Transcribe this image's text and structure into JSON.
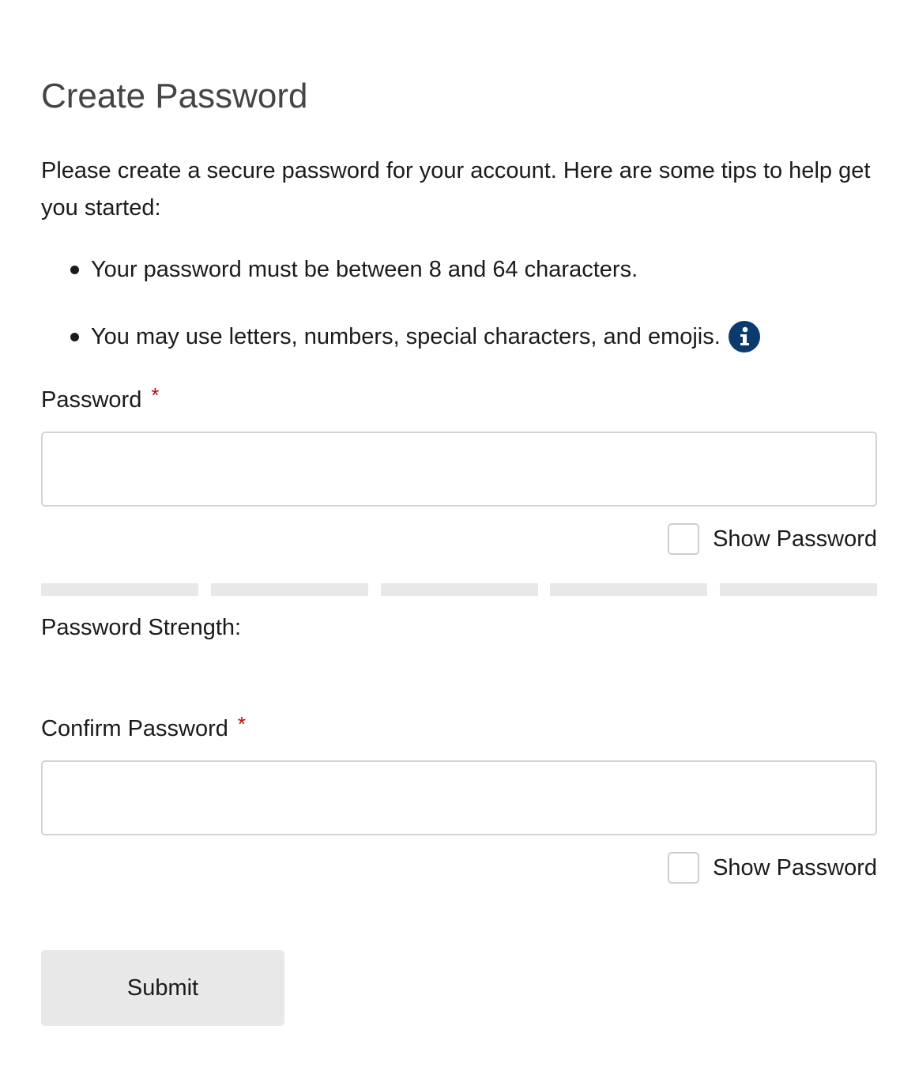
{
  "page": {
    "title": "Create Password",
    "intro": "Please create a secure password for your account. Here are some tips to help get you started:",
    "tips": [
      "Your password must be between 8 and 64 characters.",
      "You may use letters, numbers, special characters, and emojis."
    ],
    "info_icon": "info-icon"
  },
  "password": {
    "label": "Password",
    "required_mark": "*",
    "value": "",
    "show_label": "Show Password",
    "show_checked": false
  },
  "strength": {
    "label": "Password Strength:",
    "segments_total": 5,
    "segments_filled": 0,
    "empty_color": "#e8e8e8"
  },
  "confirm": {
    "label": "Confirm Password",
    "required_mark": "*",
    "value": "",
    "show_label": "Show Password",
    "show_checked": false
  },
  "submit": {
    "label": "Submit"
  },
  "colors": {
    "required": "#b50909",
    "info_icon_bg": "#0b3b6d",
    "button_bg": "#e8e8e8",
    "title": "#454545"
  }
}
